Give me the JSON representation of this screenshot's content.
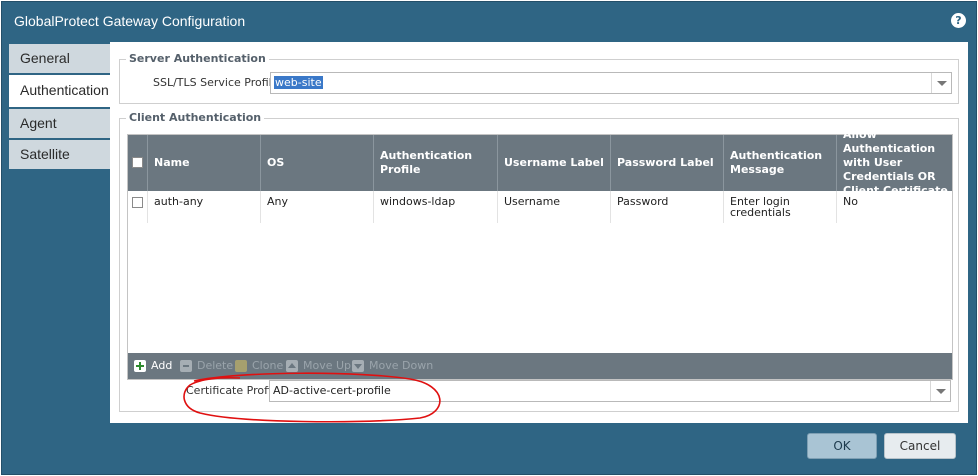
{
  "window": {
    "title": "GlobalProtect Gateway Configuration",
    "help_icon": "?"
  },
  "tabs": [
    {
      "label": "General"
    },
    {
      "label": "Authentication"
    },
    {
      "label": "Agent"
    },
    {
      "label": "Satellite"
    }
  ],
  "active_tab": "Authentication",
  "server_auth": {
    "legend": "Server Authentication",
    "ssl_label": "SSL/TLS Service Profile",
    "ssl_value": "web-site"
  },
  "client_auth": {
    "legend": "Client Authentication",
    "columns": [
      "Name",
      "OS",
      "Authentication Profile",
      "Username Label",
      "Password Label",
      "Authentication Message",
      "Allow Authentication with User Credentials OR Client Certificate"
    ],
    "rows": [
      {
        "name": "auth-any",
        "os": "Any",
        "auth_profile": "windows-ldap",
        "username_label": "Username",
        "password_label": "Password",
        "auth_message": "Enter login credentials",
        "allow_auth": "No"
      }
    ],
    "toolbar": {
      "add": "Add",
      "delete": "Delete",
      "clone": "Clone",
      "move_up": "Move Up",
      "move_down": "Move Down"
    }
  },
  "certificate_profile": {
    "label": "Certificate Profile",
    "value": "AD-active-cert-profile"
  },
  "buttons": {
    "ok": "OK",
    "cancel": "Cancel"
  },
  "colors": {
    "dialog_bg": "#2f6584",
    "grid_header": "#6b7780",
    "selection": "#3a78c8",
    "annotation": "#e01010"
  }
}
